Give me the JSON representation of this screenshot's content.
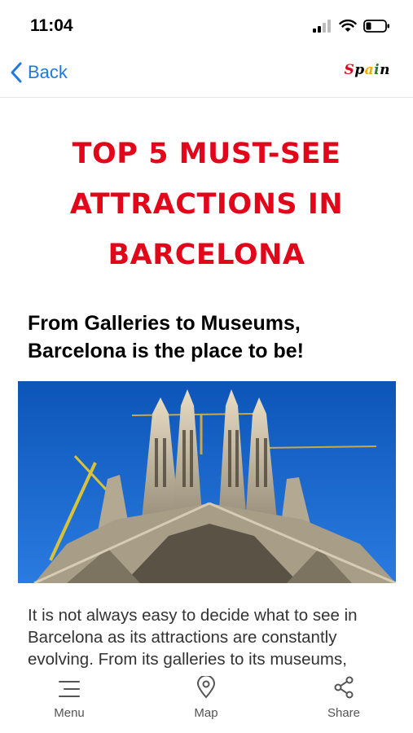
{
  "status_bar": {
    "time": "11:04"
  },
  "nav": {
    "back_label": "Back",
    "logo_text": "Spain"
  },
  "article": {
    "title": "TOP 5 MUST-SEE ATTRACTIONS IN BARCELONA",
    "subtitle": "From Galleries to Museums, Barcelona is the place to be!",
    "body": "It is not always easy to decide what to see in Barcelona as its attractions are constantly evolving. From its galleries to its museums,"
  },
  "tabs": [
    {
      "label": "Menu",
      "icon": "menu-icon"
    },
    {
      "label": "Map",
      "icon": "map-pin-icon"
    },
    {
      "label": "Share",
      "icon": "share-icon"
    }
  ],
  "colors": {
    "accent": "#1f7ae0",
    "title": "#e1061a"
  }
}
